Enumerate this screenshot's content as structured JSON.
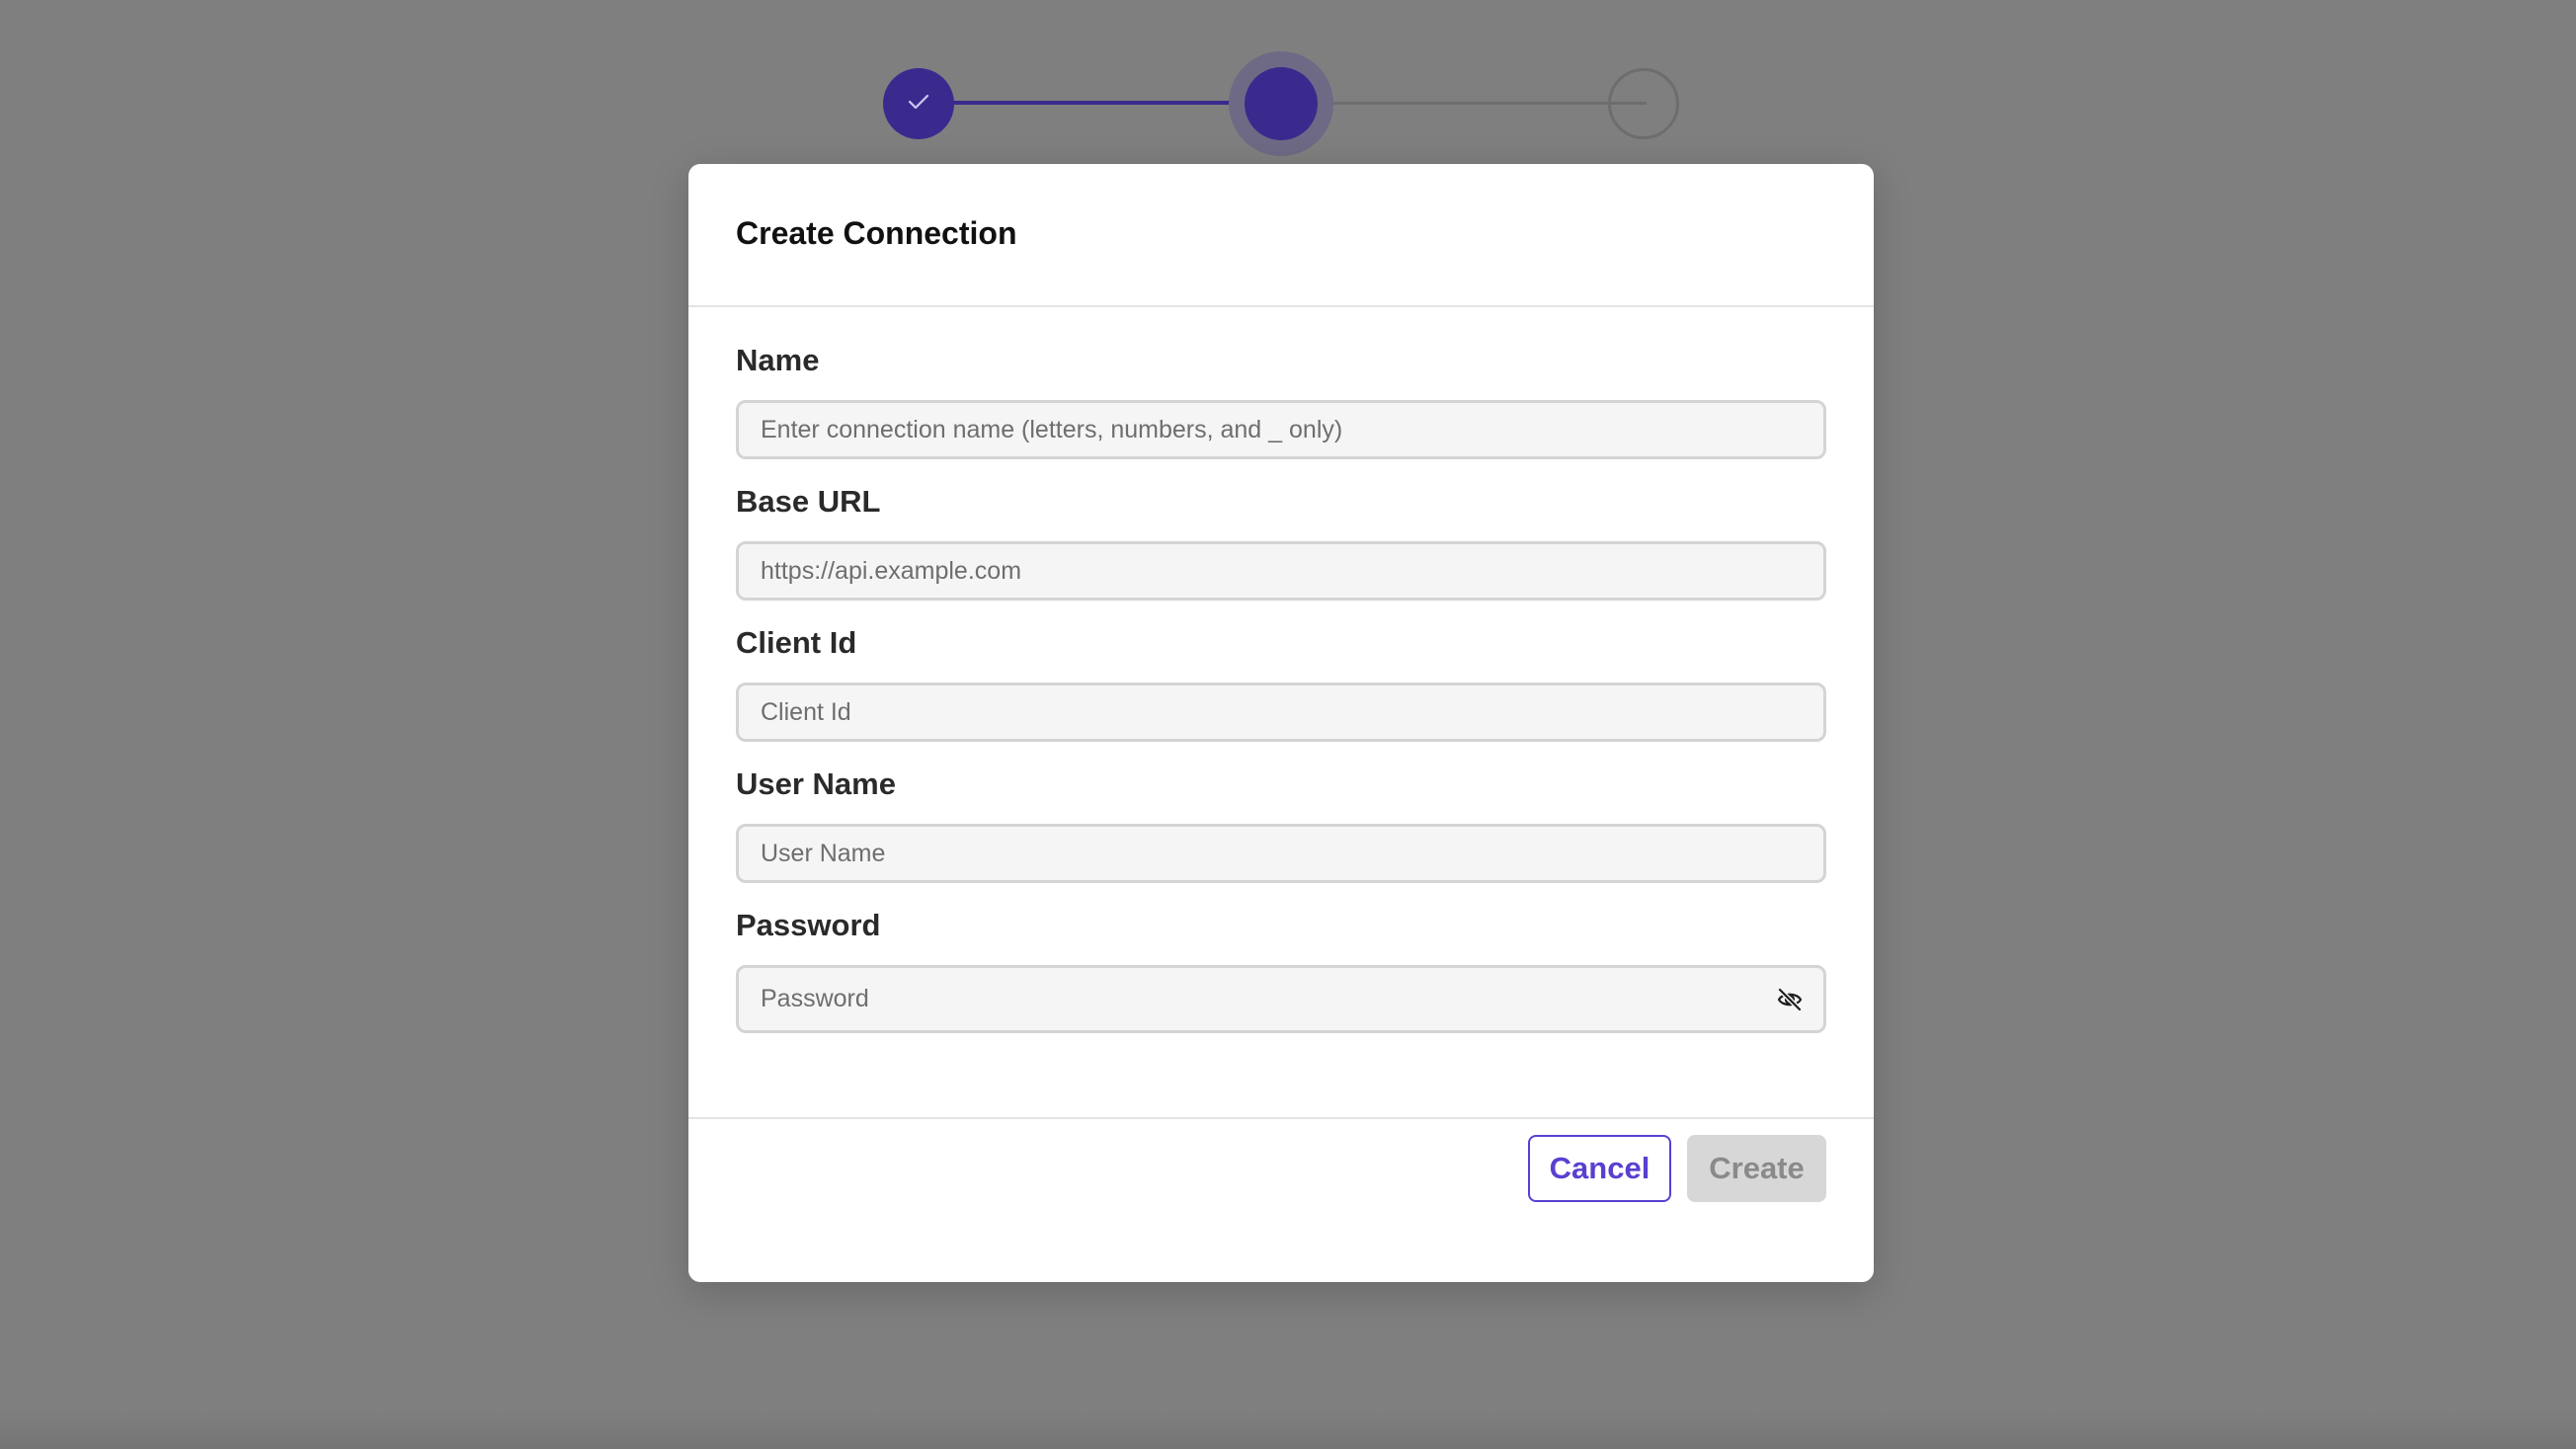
{
  "stepper": {
    "steps": [
      {
        "state": "completed",
        "icon": "check-icon"
      },
      {
        "state": "active"
      },
      {
        "state": "pending"
      }
    ],
    "colors": {
      "active": "#3b2a8e",
      "pending": "#6d6d6d"
    }
  },
  "modal": {
    "title": "Create Connection",
    "fields": [
      {
        "label": "Name",
        "placeholder": "Enter connection name (letters, numbers, and _ only)",
        "value": ""
      },
      {
        "label": "Base URL",
        "placeholder": "https://api.example.com",
        "value": ""
      },
      {
        "label": "Client Id",
        "placeholder": "Client Id",
        "value": ""
      },
      {
        "label": "User Name",
        "placeholder": "User Name",
        "value": ""
      },
      {
        "label": "Password",
        "placeholder": "Password",
        "value": "",
        "toggle_icon": "eye-off-icon"
      }
    ],
    "buttons": {
      "cancel": "Cancel",
      "create": "Create"
    }
  },
  "colors": {
    "accent": "#5a3fd1",
    "overlay": "#7f7f7f",
    "disabled_button": "#d7d7d7"
  }
}
